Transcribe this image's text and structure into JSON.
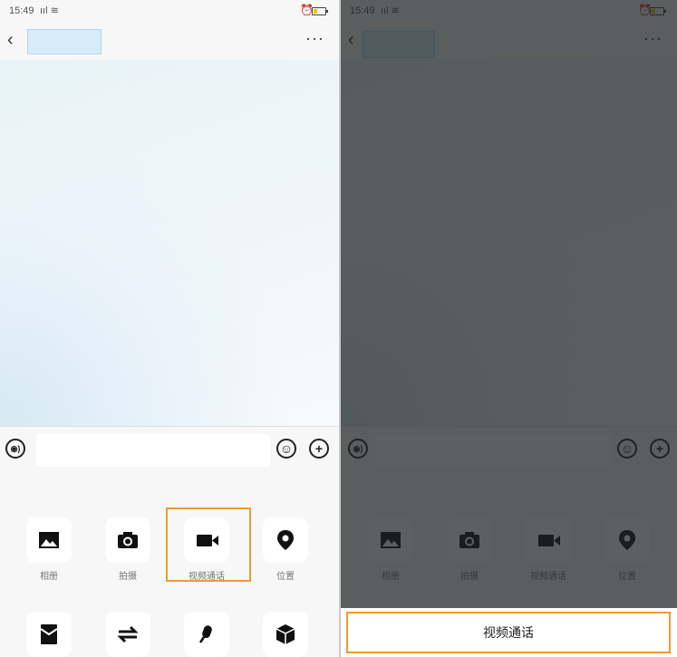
{
  "status": {
    "time": "15:49",
    "signal": "ᵢₗ ⌔"
  },
  "nav": {
    "back": "‹",
    "more": "···"
  },
  "tools_row1": [
    {
      "label": "相册",
      "icon": "photo-icon"
    },
    {
      "label": "拍摄",
      "icon": "camera-icon"
    },
    {
      "label": "视频通话",
      "icon": "video-icon"
    },
    {
      "label": "位置",
      "icon": "location-icon"
    }
  ],
  "tools_row2": [
    {
      "icon": "red-packet-icon"
    },
    {
      "icon": "transfer-icon"
    },
    {
      "icon": "voice-input-icon"
    },
    {
      "icon": "box-icon"
    }
  ],
  "action_sheet": {
    "video_call": "视频通话"
  },
  "colors": {
    "highlight": "#ef9b2a",
    "overlay": "#1e2224"
  }
}
